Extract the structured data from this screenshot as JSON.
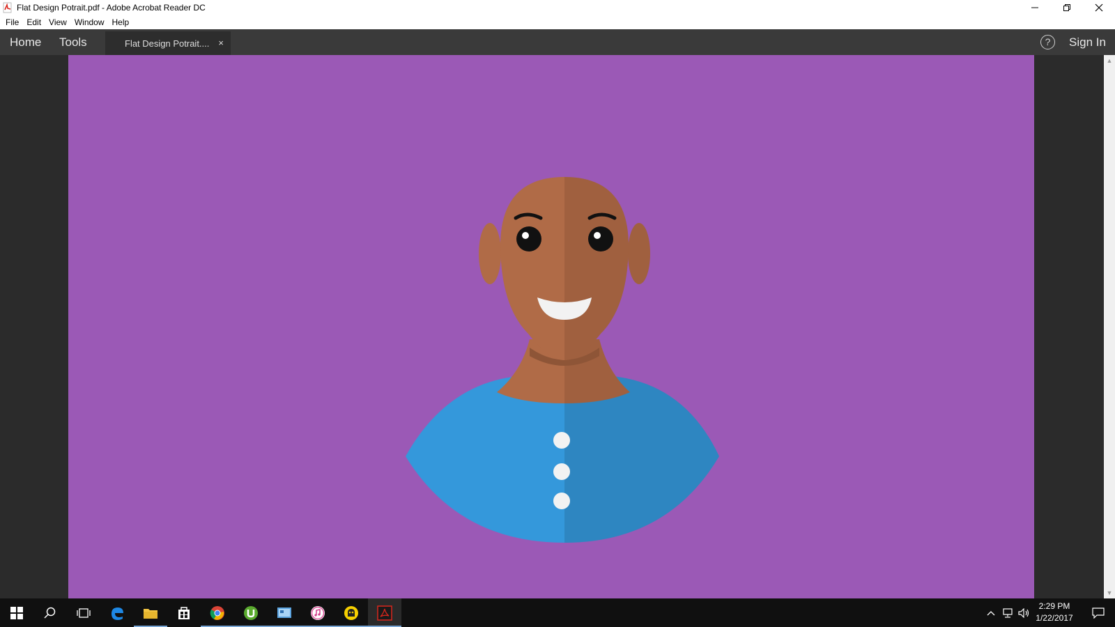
{
  "window": {
    "title": "Flat Design Potrait.pdf - Adobe Acrobat Reader DC"
  },
  "menu": [
    "File",
    "Edit",
    "View",
    "Window",
    "Help"
  ],
  "nav": {
    "home": "Home",
    "tools": "Tools",
    "tab_title": "Flat Design Potrait....",
    "tab_close": "×",
    "help": "?",
    "sign_in": "Sign In"
  },
  "document": {
    "background_color": "#9b59b6",
    "skin_light": "#b06b47",
    "skin_dark": "#a0603f",
    "shirt_light": "#3498db",
    "shirt_dark": "#2e86c1"
  },
  "taskbar": {
    "apps": [
      "windows-start",
      "search",
      "task-view",
      "edge",
      "file-explorer",
      "store",
      "chrome",
      "utorrent",
      "control-panel",
      "itunes",
      "cyberghost",
      "acrobat-reader"
    ],
    "time": "2:29 PM",
    "date": "1/22/2017"
  }
}
